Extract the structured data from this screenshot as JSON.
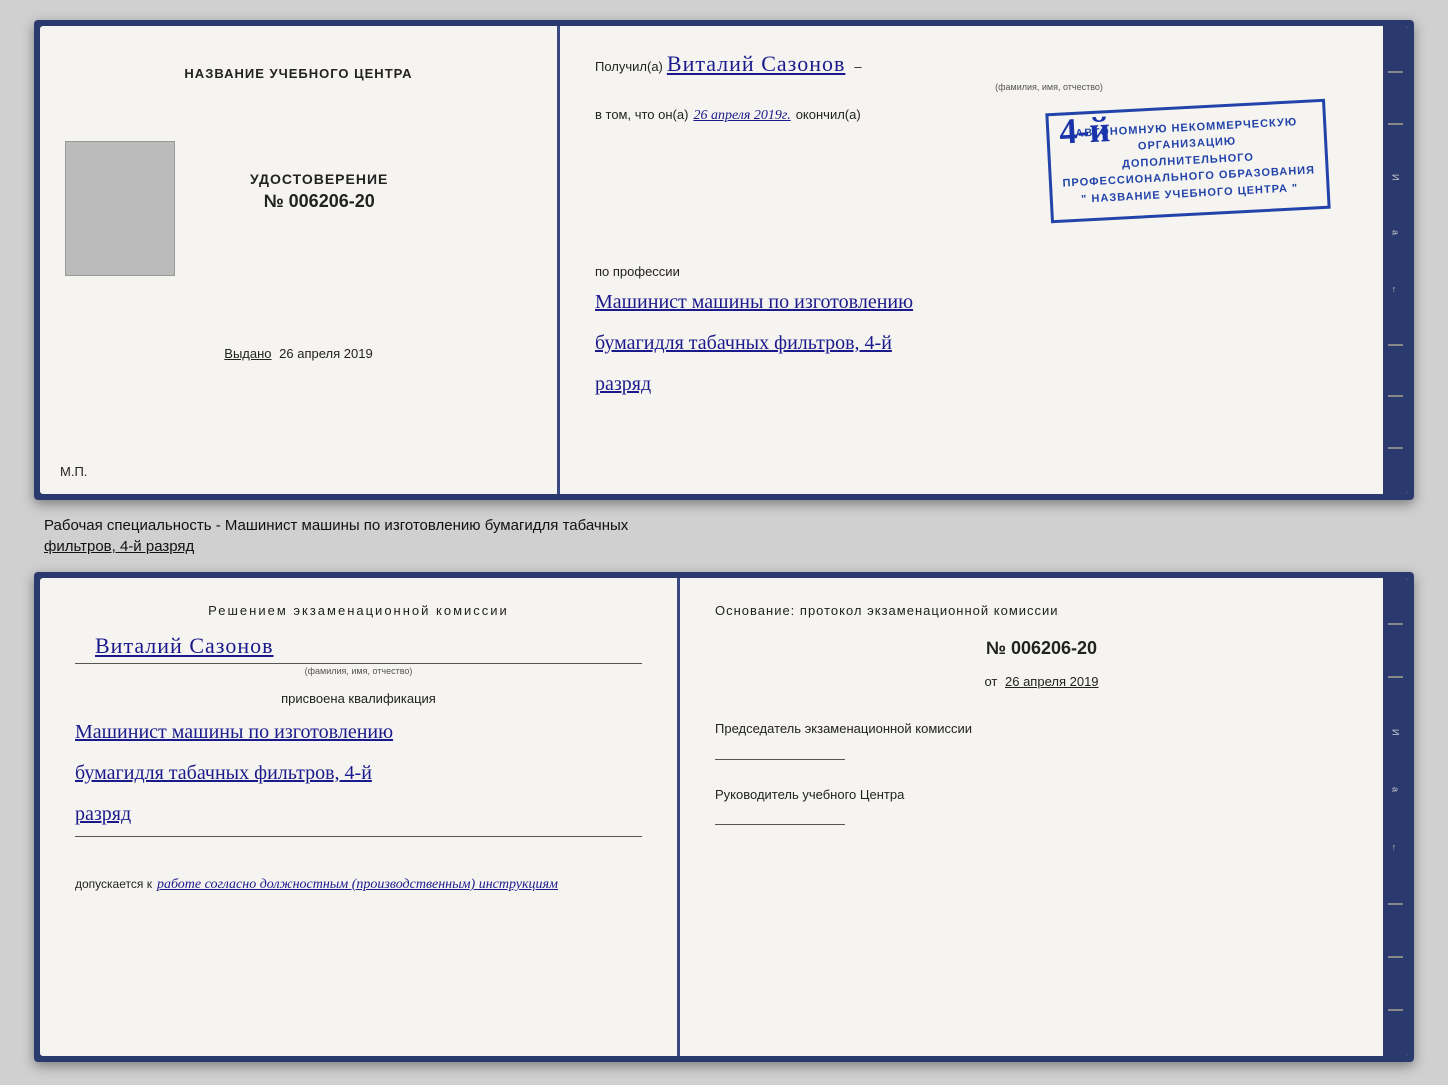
{
  "page": {
    "background_color": "#d0d0d0"
  },
  "top_certificate": {
    "left_page": {
      "center_title": "НАЗВАНИЕ УЧЕБНОГО ЦЕНТРА",
      "udostoverenie_label": "УДОСТОВЕРЕНИЕ",
      "number": "№ 006206-20",
      "vydano_label": "Выдано",
      "vydano_date": "26 апреля 2019",
      "mp_label": "М.П."
    },
    "right_page": {
      "poluchil_label": "Получил(а)",
      "recipient_name": "Виталий Сазонов",
      "fio_sublabel": "(фамилия, имя, отчество)",
      "vtom_prefix": "в том, что он(а)",
      "date_handwritten": "26 апреля 2019г.",
      "okonchil_label": "окончил(а)",
      "stamp_line1": "АВТОНОМНУЮ НЕКОММЕРЧЕСКУЮ ОРГАНИЗАЦИЮ",
      "stamp_line2": "ДОПОЛНИТЕЛЬНОГО ПРОФЕССИОНАЛЬНОГО ОБРАЗОВАНИЯ",
      "stamp_line3": "\" НАЗВАНИЕ УЧЕБНОГО ЦЕНТРА \"",
      "stamp_number": "4-й",
      "po_professii_label": "по профессии",
      "profession_line1": "Машинист машины по изготовлению",
      "profession_line2": "бумагидля табачных фильтров, 4-й",
      "profession_line3": "разряд"
    }
  },
  "caption": {
    "text": "Рабочая специальность - Машинист машины по изготовлению бумагидля табачных",
    "text2": "фильтров, 4-й разряд"
  },
  "bottom_certificate": {
    "left_page": {
      "resheniyem_label": "Решением экзаменационной комиссии",
      "recipient_name": "Виталий Сазонов",
      "fio_sublabel": "(фамилия, имя, отчество)",
      "prisvoena_label": "присвоена квалификация",
      "qualification_line1": "Машинист машины по изготовлению",
      "qualification_line2": "бумагидля табачных фильтров, 4-й",
      "qualification_line3": "разряд",
      "dopuskaetsya_label": "допускается к",
      "dopuskaetsya_value": "работе согласно должностным (производственным) инструкциям"
    },
    "right_page": {
      "osnovanie_label": "Основание: протокол экзаменационной комиссии",
      "protocol_number": "№ 006206-20",
      "ot_label": "от",
      "ot_date": "26 апреля 2019",
      "predsedatel_label": "Председатель экзаменационной комиссии",
      "rukovoditel_label": "Руководитель учебного Центра"
    }
  }
}
